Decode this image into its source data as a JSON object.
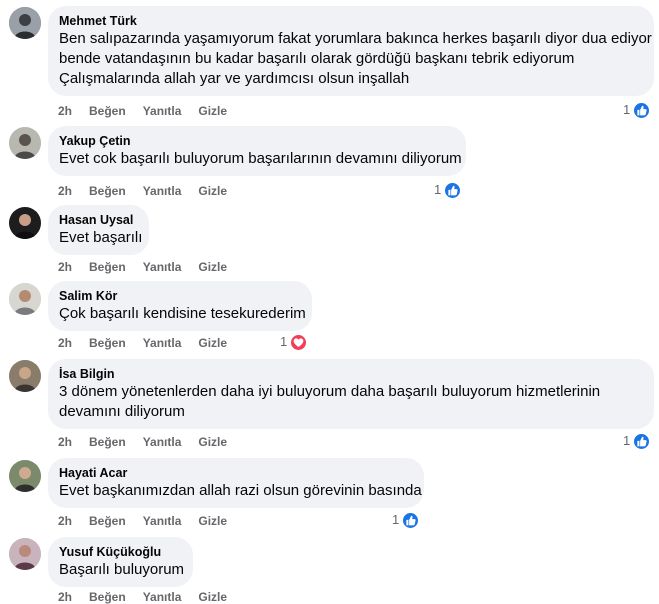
{
  "comments": [
    {
      "author": "Mehmet Türk",
      "lines": [
        "Ben salıpazarında yaşamıyorum fakat yorumlara bakınca herkes başarılı diyor dua ediyor",
        "bende vatandaşının bu kadar başarılı olarak gördüğü başkanı tebrik ediyorum",
        "Çalışmalarında allah yar ve yardımcısı olsun inşallah"
      ],
      "time": "2h",
      "like": "Beğen",
      "reply": "Yanıtla",
      "hide": "Gizle",
      "reaction_count": "1",
      "reaction_icon": "like-icon"
    },
    {
      "author": "Yakup Çetin",
      "lines": [
        "Evet cok başarılı buluyorum başarılarının devamını diliyorum"
      ],
      "time": "2h",
      "like": "Beğen",
      "reply": "Yanıtla",
      "hide": "Gizle",
      "reaction_count": "1",
      "reaction_icon": "like-icon"
    },
    {
      "author": "Hasan Uysal",
      "lines": [
        "Evet başarılı"
      ],
      "time": "2h",
      "like": "Beğen",
      "reply": "Yanıtla",
      "hide": "Gizle"
    },
    {
      "author": "Salim Kör",
      "lines": [
        "Çok başarılı kendisine tesekurederim"
      ],
      "time": "2h",
      "like": "Beğen",
      "reply": "Yanıtla",
      "hide": "Gizle",
      "reaction_count": "1",
      "reaction_icon": "love-icon"
    },
    {
      "author": "İsa Bilgin",
      "lines": [
        "3 dönem yönetenlerden daha iyi buluyorum daha başarılı buluyorum hizmetlerinin",
        "devamını diliyorum"
      ],
      "time": "2h",
      "like": "Beğen",
      "reply": "Yanıtla",
      "hide": "Gizle",
      "reaction_count": "1",
      "reaction_icon": "like-icon"
    },
    {
      "author": "Hayati Acar",
      "lines": [
        "Evet başkanımızdan allah razi olsun görevinin basında"
      ],
      "time": "2h",
      "like": "Beğen",
      "reply": "Yanıtla",
      "hide": "Gizle",
      "reaction_count": "1",
      "reaction_icon": "like-icon"
    },
    {
      "author": "Yusuf Küçükoğlu",
      "lines": [
        "Başarılı buluyorum"
      ],
      "time": "2h",
      "like": "Beğen",
      "reply": "Yanıtla",
      "hide": "Gizle"
    }
  ],
  "colors": {
    "bubble": "#f0f2f5",
    "meta": "#65676b",
    "like_blue": "#1b74e4",
    "love_red": "#f33e58"
  }
}
